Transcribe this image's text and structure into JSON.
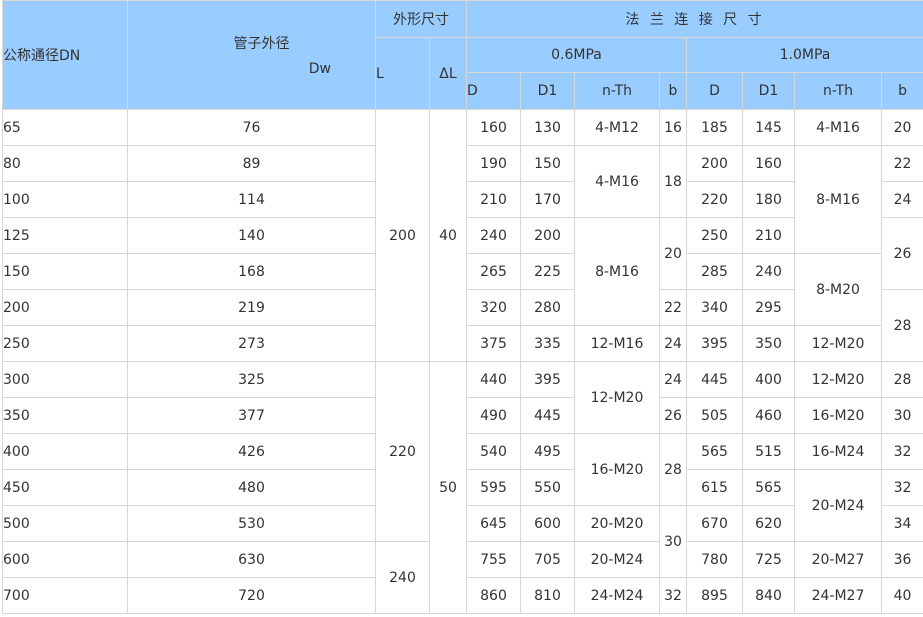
{
  "header": {
    "dn": "公称通径DN",
    "pipe_od": "管子外径",
    "dw": "Dw",
    "outline": "外形尺寸",
    "flange": "法 兰 连 接 尺 寸",
    "p06": "0.6MPa",
    "p10": "1.0MPa",
    "L": "L",
    "dL": "ΔL",
    "D": "D",
    "D1": "D1",
    "nth": "n-Th",
    "b": "b"
  },
  "rows": [
    {
      "dn": "65",
      "dw": "76",
      "d_06": "160",
      "d1_06": "130",
      "d_10": "185",
      "d1_10": "145"
    },
    {
      "dn": "80",
      "dw": "89",
      "d_06": "190",
      "d1_06": "150",
      "d_10": "200",
      "d1_10": "160"
    },
    {
      "dn": "100",
      "dw": "114",
      "d_06": "210",
      "d1_06": "170",
      "d_10": "220",
      "d1_10": "180"
    },
    {
      "dn": "125",
      "dw": "140",
      "d_06": "240",
      "d1_06": "200",
      "d_10": "250",
      "d1_10": "210"
    },
    {
      "dn": "150",
      "dw": "168",
      "d_06": "265",
      "d1_06": "225",
      "d_10": "285",
      "d1_10": "240"
    },
    {
      "dn": "200",
      "dw": "219",
      "d_06": "320",
      "d1_06": "280",
      "d_10": "340",
      "d1_10": "295"
    },
    {
      "dn": "250",
      "dw": "273",
      "d_06": "375",
      "d1_06": "335",
      "d_10": "395",
      "d1_10": "350"
    },
    {
      "dn": "300",
      "dw": "325",
      "d_06": "440",
      "d1_06": "395",
      "d_10": "445",
      "d1_10": "400"
    },
    {
      "dn": "350",
      "dw": "377",
      "d_06": "490",
      "d1_06": "445",
      "d_10": "505",
      "d1_10": "460"
    },
    {
      "dn": "400",
      "dw": "426",
      "d_06": "540",
      "d1_06": "495",
      "d_10": "565",
      "d1_10": "515"
    },
    {
      "dn": "450",
      "dw": "480",
      "d_06": "595",
      "d1_06": "550",
      "d_10": "615",
      "d1_10": "565"
    },
    {
      "dn": "500",
      "dw": "530",
      "d_06": "645",
      "d1_06": "600",
      "d_10": "670",
      "d1_10": "620"
    },
    {
      "dn": "600",
      "dw": "630",
      "d_06": "755",
      "d1_06": "705",
      "d_10": "780",
      "d1_10": "725"
    },
    {
      "dn": "700",
      "dw": "720",
      "d_06": "860",
      "d1_06": "810",
      "d_10": "895",
      "d1_10": "840"
    }
  ],
  "groups": {
    "L": [
      "200",
      "220",
      "240"
    ],
    "dL": [
      "40",
      "50"
    ],
    "nth_06": [
      "4-M12",
      "4-M16",
      "8-M16",
      "12-M16",
      "12-M20",
      "16-M20",
      "20-M20",
      "20-M24",
      "24-M24"
    ],
    "b_06": [
      "16",
      "18",
      "20",
      "22",
      "24",
      "24",
      "26",
      "28",
      "30",
      "32"
    ],
    "nth_10": [
      "4-M16",
      "8-M16",
      "8-M20",
      "12-M20",
      "12-M20",
      "16-M20",
      "16-M24",
      "20-M24",
      "20-M27",
      "24-M27"
    ],
    "b_10": [
      "20",
      "22",
      "24",
      "26",
      "28",
      "28",
      "30",
      "32",
      "32",
      "34",
      "36",
      "40"
    ]
  }
}
